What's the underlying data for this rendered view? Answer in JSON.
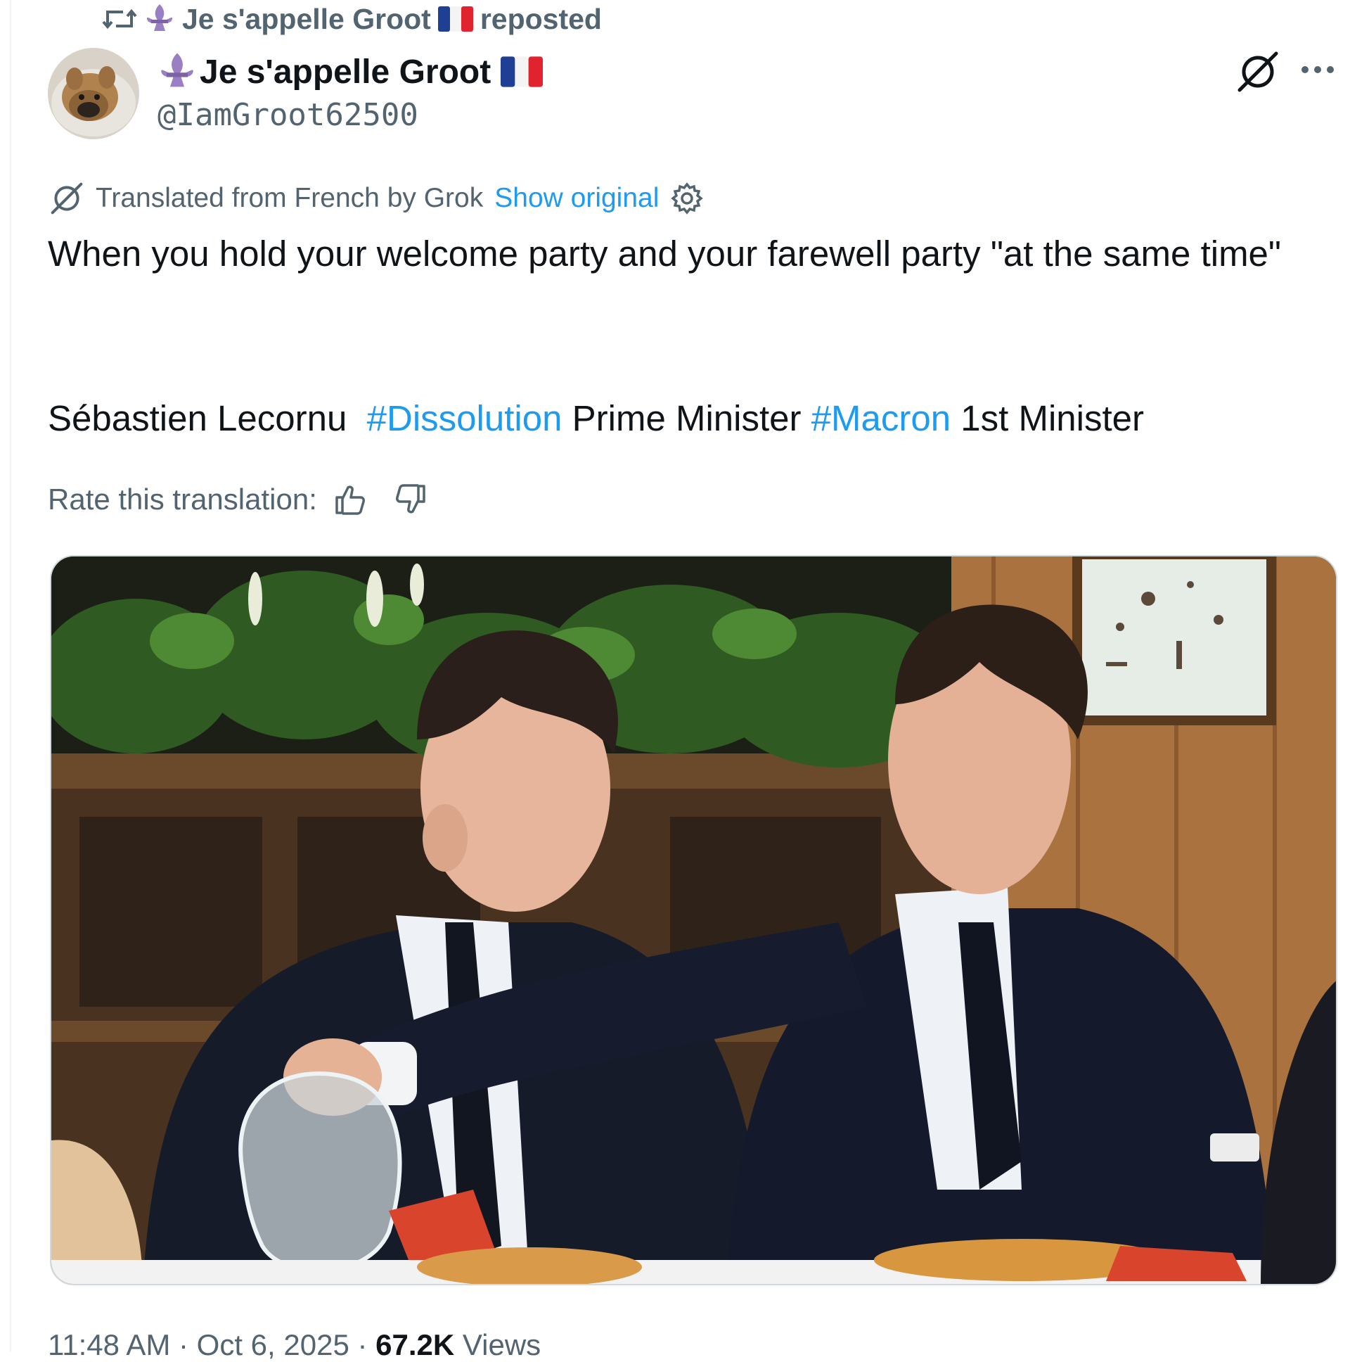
{
  "repost": {
    "icon": "repost-icon",
    "user_name": "Je s'appelle Groot",
    "label": "reposted"
  },
  "author": {
    "display_name": "Je s'appelle Groot",
    "handle": "@IamGroot62500",
    "avatar": "french-bulldog-avatar",
    "name_emoji": [
      "fleur-de-lis-icon",
      "france-flag-icon"
    ]
  },
  "actions": {
    "grok_icon": "grok-icon",
    "more_icon": "more-icon"
  },
  "translation": {
    "notice": "Translated from French by Grok",
    "show_original": "Show original",
    "settings_icon": "gear-icon",
    "rate_label": "Rate this translation:",
    "thumbs_up_icon": "thumbs-up-icon",
    "thumbs_down_icon": "thumbs-down-icon"
  },
  "tweet": {
    "text": "When you hold your welcome party and your farewell party \"at the same time\"",
    "line2": {
      "name": "Sébastien Lecornu",
      "hashtag1": "#Dissolution",
      "mid": "Prime Minister",
      "hashtag2": "#Macron",
      "end": "1st Minister"
    }
  },
  "media": {
    "type": "photo",
    "description_icon": "photo"
  },
  "footer": {
    "time": "11:48 AM",
    "date": "Oct 6, 2025",
    "views_count": "67.2K",
    "views_label": "Views"
  },
  "colors": {
    "link": "#1d9bf0",
    "secondary": "#536471",
    "primary": "#0f1419"
  }
}
